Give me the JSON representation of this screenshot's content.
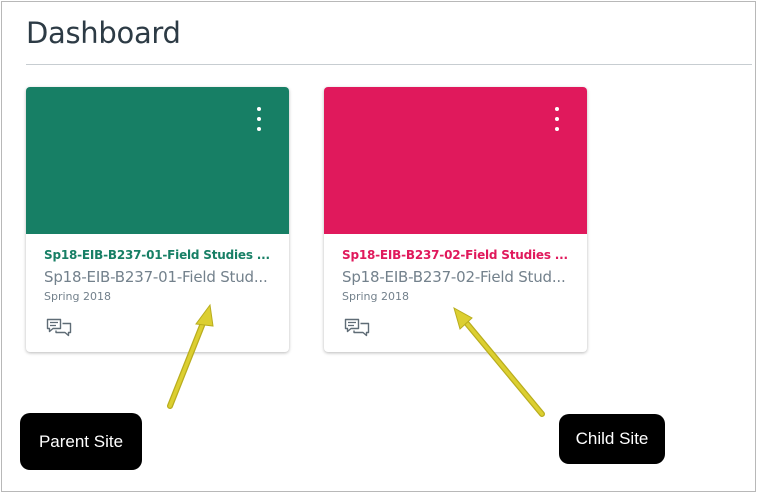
{
  "page": {
    "title": "Dashboard"
  },
  "cards": [
    {
      "name": "Sp18-EIB-B237-01-Field Studies ...",
      "code": "Sp18-EIB-B237-01-Field Stud...",
      "term": "Spring 2018",
      "color": "#177f65",
      "icon": "discussions-icon"
    },
    {
      "name": "Sp18-EIB-B237-02-Field Studies ...",
      "code": "Sp18-EIB-B237-02-Field Stud...",
      "term": "Spring 2018",
      "color": "#e0195c",
      "icon": "discussions-icon"
    }
  ],
  "annotations": {
    "parent_label": "Parent Site",
    "child_label": "Child Site",
    "arrow_color": "#d9cd2b"
  }
}
